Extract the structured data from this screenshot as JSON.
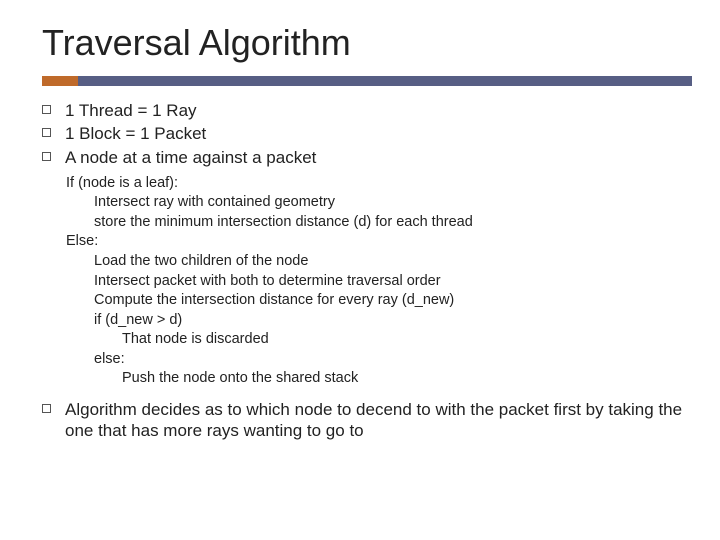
{
  "title": "Traversal Algorithm",
  "accent_color": "#bf6a2a",
  "rule_color": "#575e84",
  "top_bullets": [
    "1 Thread = 1 Ray",
    "1 Block = 1 Packet",
    "A node at a time against a packet"
  ],
  "pseudocode": [
    {
      "indent": 0,
      "text": "If (node is a leaf):"
    },
    {
      "indent": 1,
      "text": "Intersect ray with contained geometry"
    },
    {
      "indent": 1,
      "text": "store the minimum intersection distance (d) for each thread"
    },
    {
      "indent": 0,
      "text": "Else:"
    },
    {
      "indent": 1,
      "text": "Load the two children of the node"
    },
    {
      "indent": 1,
      "text": "Intersect packet with both to determine traversal order"
    },
    {
      "indent": 1,
      "text": "Compute the intersection distance for every ray (d_new)"
    },
    {
      "indent": 1,
      "text": "if (d_new > d)"
    },
    {
      "indent": 2,
      "text": "That node is discarded"
    },
    {
      "indent": 1,
      "text": "else:"
    },
    {
      "indent": 2,
      "text": "Push the node onto the shared stack"
    }
  ],
  "bottom_bullets": [
    "Algorithm decides as to which node to decend to with the packet first by taking the one that has more rays wanting to go to"
  ]
}
